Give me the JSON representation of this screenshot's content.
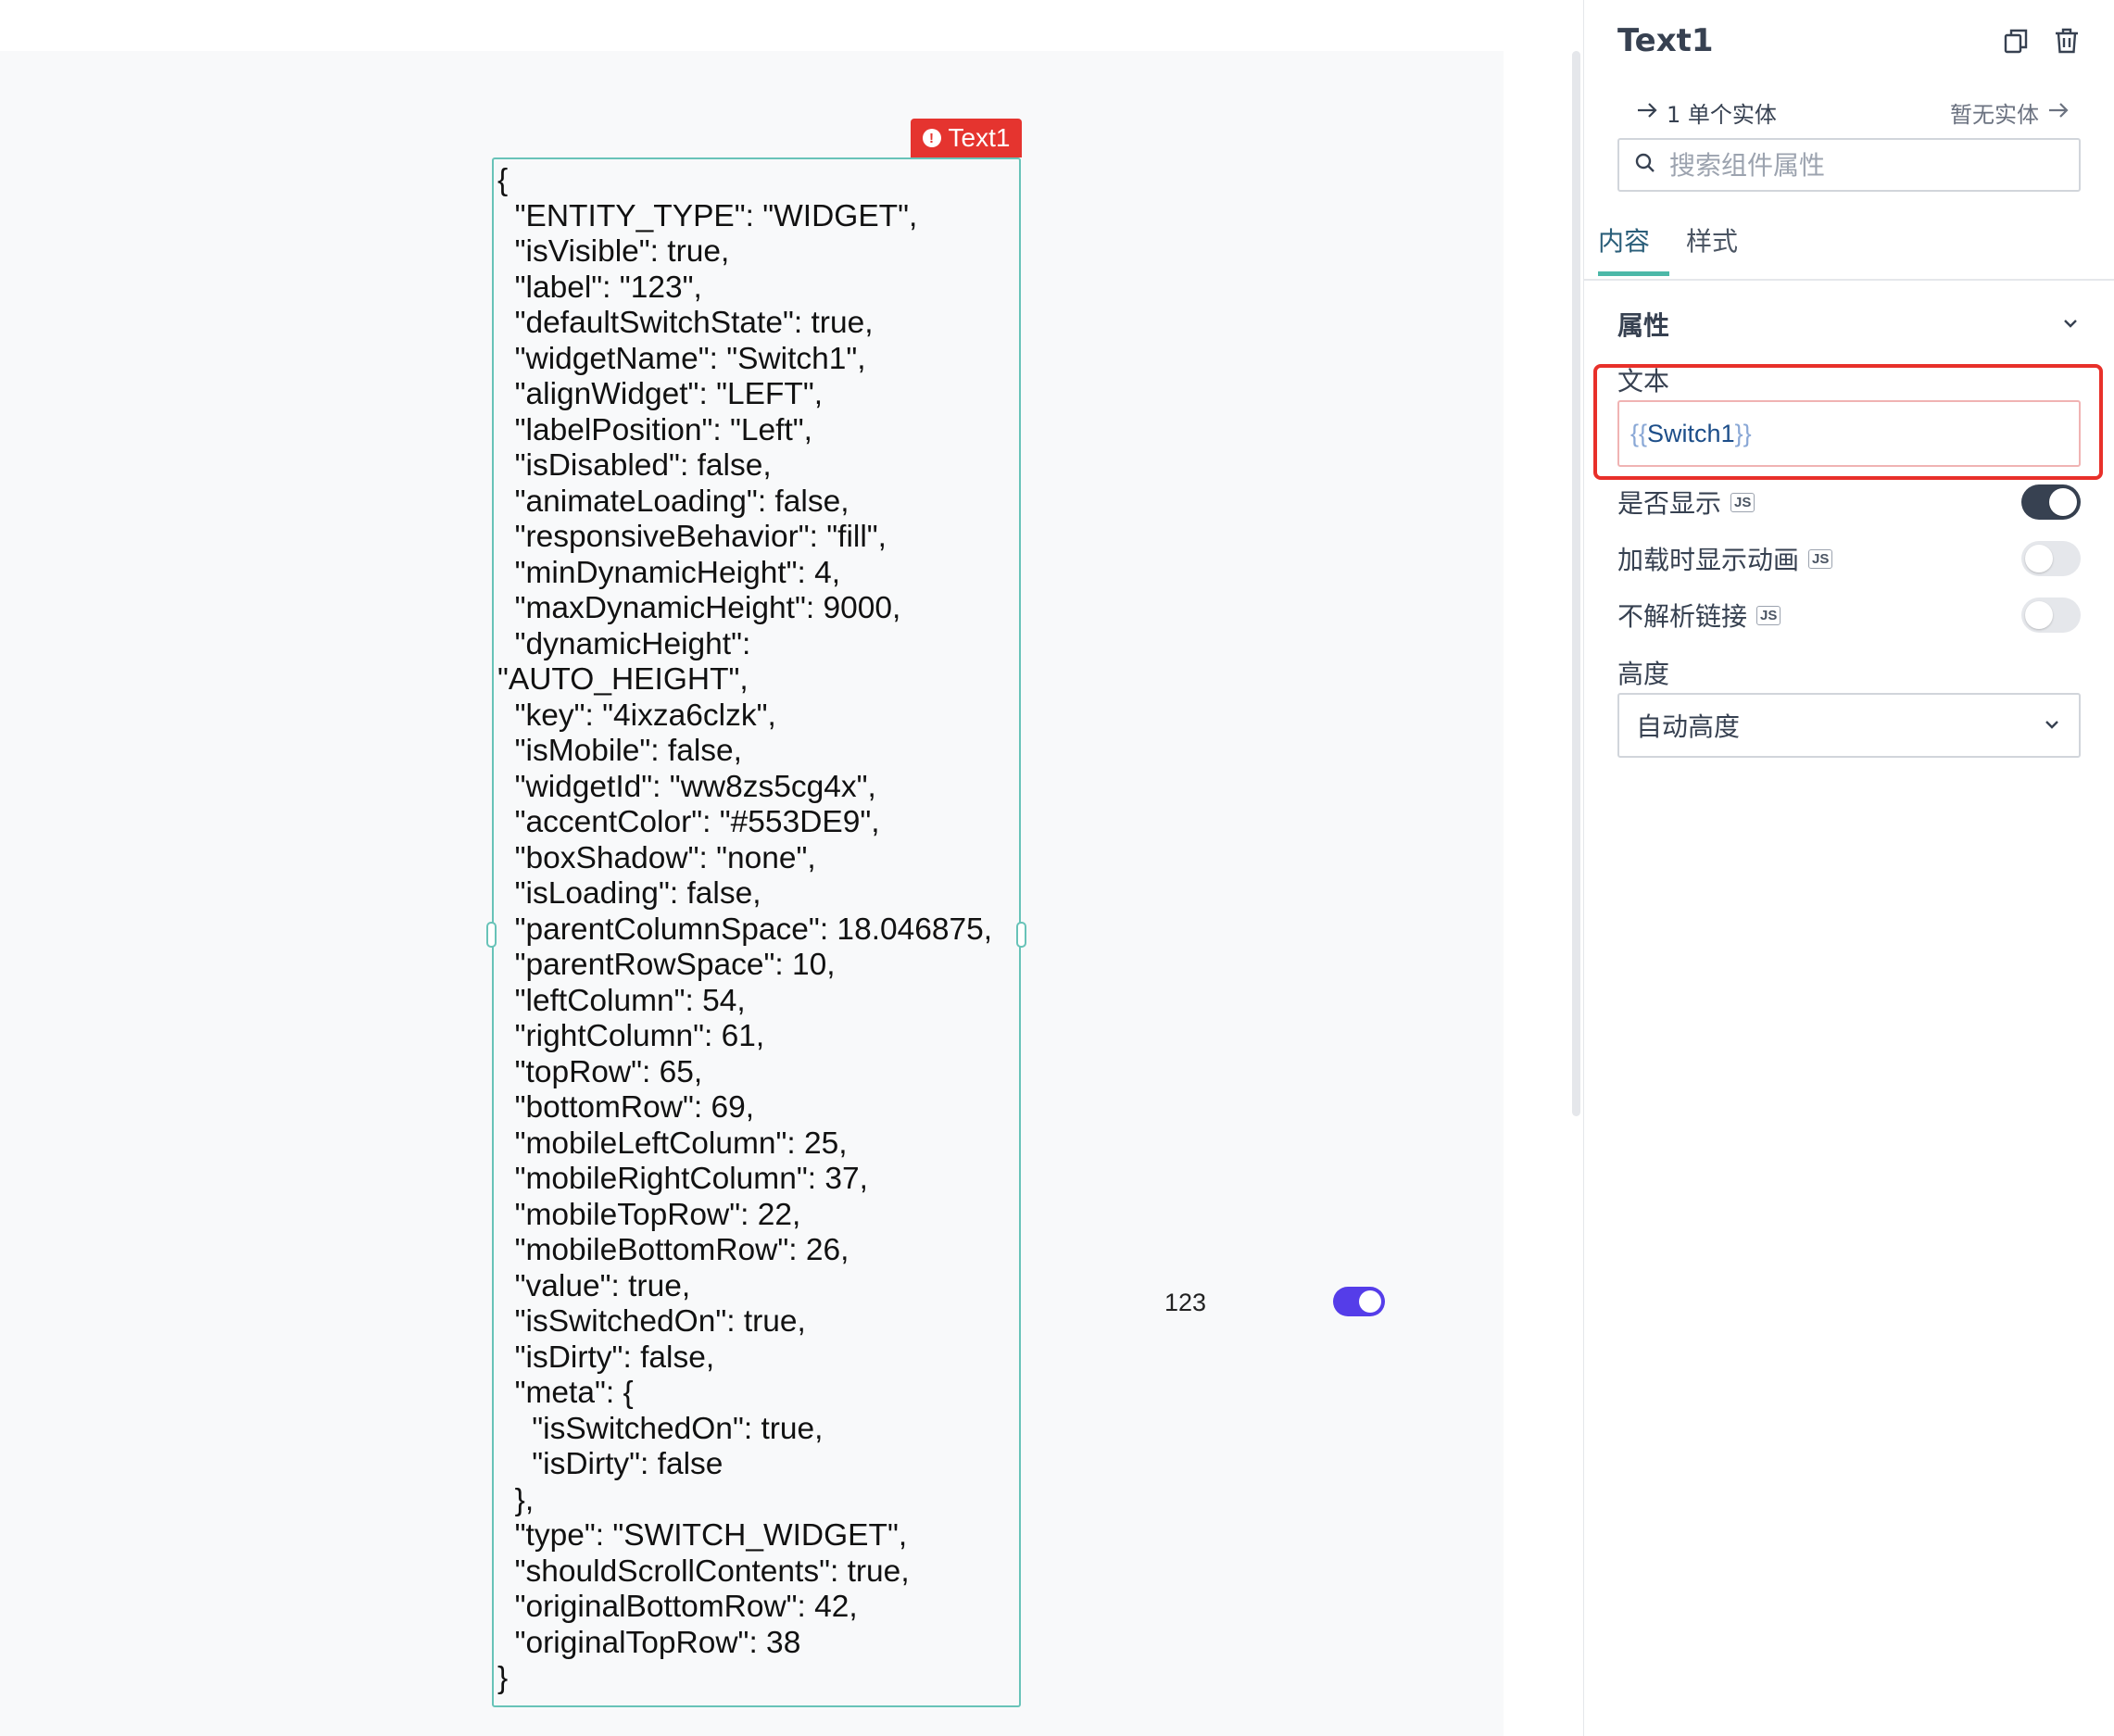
{
  "canvas": {
    "widget_tag": "Text1",
    "text_content": "{\n  \"ENTITY_TYPE\": \"WIDGET\",\n  \"isVisible\": true,\n  \"label\": \"123\",\n  \"defaultSwitchState\": true,\n  \"widgetName\": \"Switch1\",\n  \"alignWidget\": \"LEFT\",\n  \"labelPosition\": \"Left\",\n  \"isDisabled\": false,\n  \"animateLoading\": false,\n  \"responsiveBehavior\": \"fill\",\n  \"minDynamicHeight\": 4,\n  \"maxDynamicHeight\": 9000,\n  \"dynamicHeight\":\n\"AUTO_HEIGHT\",\n  \"key\": \"4ixza6clzk\",\n  \"isMobile\": false,\n  \"widgetId\": \"ww8zs5cg4x\",\n  \"accentColor\": \"#553DE9\",\n  \"boxShadow\": \"none\",\n  \"isLoading\": false,\n  \"parentColumnSpace\": 18.046875,\n  \"parentRowSpace\": 10,\n  \"leftColumn\": 54,\n  \"rightColumn\": 61,\n  \"topRow\": 65,\n  \"bottomRow\": 69,\n  \"mobileLeftColumn\": 25,\n  \"mobileRightColumn\": 37,\n  \"mobileTopRow\": 22,\n  \"mobileBottomRow\": 26,\n  \"value\": true,\n  \"isSwitchedOn\": true,\n  \"isDirty\": false,\n  \"meta\": {\n    \"isSwitchedOn\": true,\n    \"isDirty\": false\n  },\n  \"type\": \"SWITCH_WIDGET\",\n  \"shouldScrollContents\": true,\n  \"originalBottomRow\": 42,\n  \"originalTopRow\": 38\n}",
    "switch_label": "123",
    "switch_on": true,
    "switch_color": "#553de9"
  },
  "pane": {
    "title": "Text1",
    "copy_icon": "copy-icon",
    "delete_icon": "trash-icon",
    "nav_left": "1 单个实体",
    "nav_right": "暂无实体",
    "search_placeholder": "搜索组件属性",
    "tabs": [
      "内容",
      "样式"
    ],
    "active_tab": "内容",
    "section_title": "属性",
    "text_field": {
      "label": "文本",
      "open": "{{",
      "value": "Switch1",
      "close": "}}"
    },
    "toggles": [
      {
        "label": "是否显示",
        "badge": "JS",
        "on": true
      },
      {
        "label": "加载时显示动画",
        "badge": "JS",
        "on": false
      },
      {
        "label": "不解析链接",
        "badge": "JS",
        "on": false
      }
    ],
    "height_field": {
      "label": "高度",
      "value": "自动高度"
    },
    "accent_color": "#4cb8a8",
    "highlight_color": "#e8302a"
  }
}
